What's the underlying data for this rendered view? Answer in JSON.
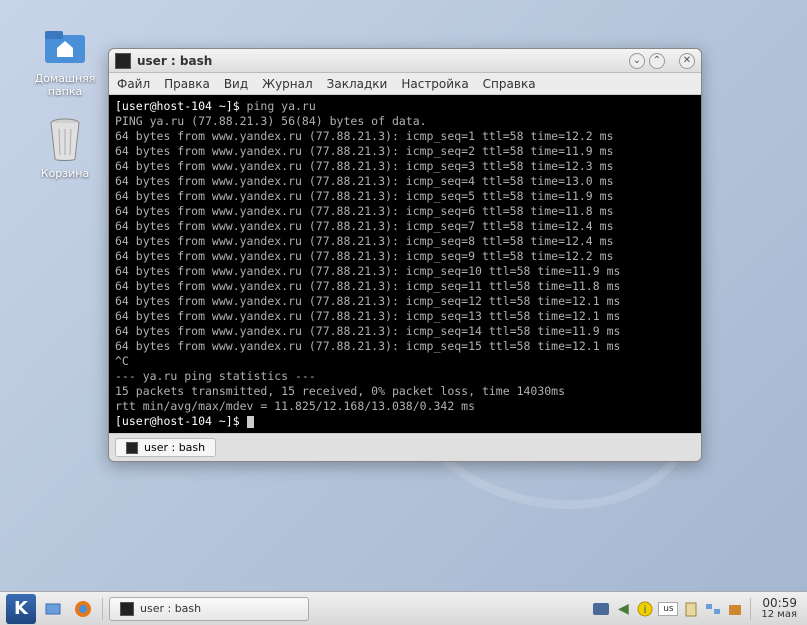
{
  "desktop": {
    "home_label": "Домашняя\nпапка",
    "trash_label": "Корзина"
  },
  "window": {
    "title": "user : bash",
    "menu": [
      "Файл",
      "Правка",
      "Вид",
      "Журнал",
      "Закладки",
      "Настройка",
      "Справка"
    ],
    "tab_label": "user : bash"
  },
  "terminal": {
    "prompt": "[user@host-104 ~]$",
    "command": "ping ya.ru",
    "header": "PING ya.ru (77.88.21.3) 56(84) bytes of data.",
    "host_from": "www.yandex.ru",
    "ip": "77.88.21.3",
    "bytes": "64 bytes from",
    "pings": [
      {
        "seq": 1,
        "ttl": 58,
        "time": "12.2"
      },
      {
        "seq": 2,
        "ttl": 58,
        "time": "11.9"
      },
      {
        "seq": 3,
        "ttl": 58,
        "time": "12.3"
      },
      {
        "seq": 4,
        "ttl": 58,
        "time": "13.0"
      },
      {
        "seq": 5,
        "ttl": 58,
        "time": "11.9"
      },
      {
        "seq": 6,
        "ttl": 58,
        "time": "11.8"
      },
      {
        "seq": 7,
        "ttl": 58,
        "time": "12.4"
      },
      {
        "seq": 8,
        "ttl": 58,
        "time": "12.4"
      },
      {
        "seq": 9,
        "ttl": 58,
        "time": "12.2"
      },
      {
        "seq": 10,
        "ttl": 58,
        "time": "11.9"
      },
      {
        "seq": 11,
        "ttl": 58,
        "time": "11.8"
      },
      {
        "seq": 12,
        "ttl": 58,
        "time": "12.1"
      },
      {
        "seq": 13,
        "ttl": 58,
        "time": "12.1"
      },
      {
        "seq": 14,
        "ttl": 58,
        "time": "11.9"
      },
      {
        "seq": 15,
        "ttl": 58,
        "time": "12.1"
      }
    ],
    "interrupt": "^C",
    "stats_hdr": "--- ya.ru ping statistics ---",
    "stats_line1": "15 packets transmitted, 15 received, 0% packet loss, time 14030ms",
    "stats_line2": "rtt min/avg/max/mdev = 11.825/12.168/13.038/0.342 ms"
  },
  "panel": {
    "task_label": "user : bash",
    "time": "00:59",
    "date": "12 мая",
    "kbd_layout": "us"
  }
}
